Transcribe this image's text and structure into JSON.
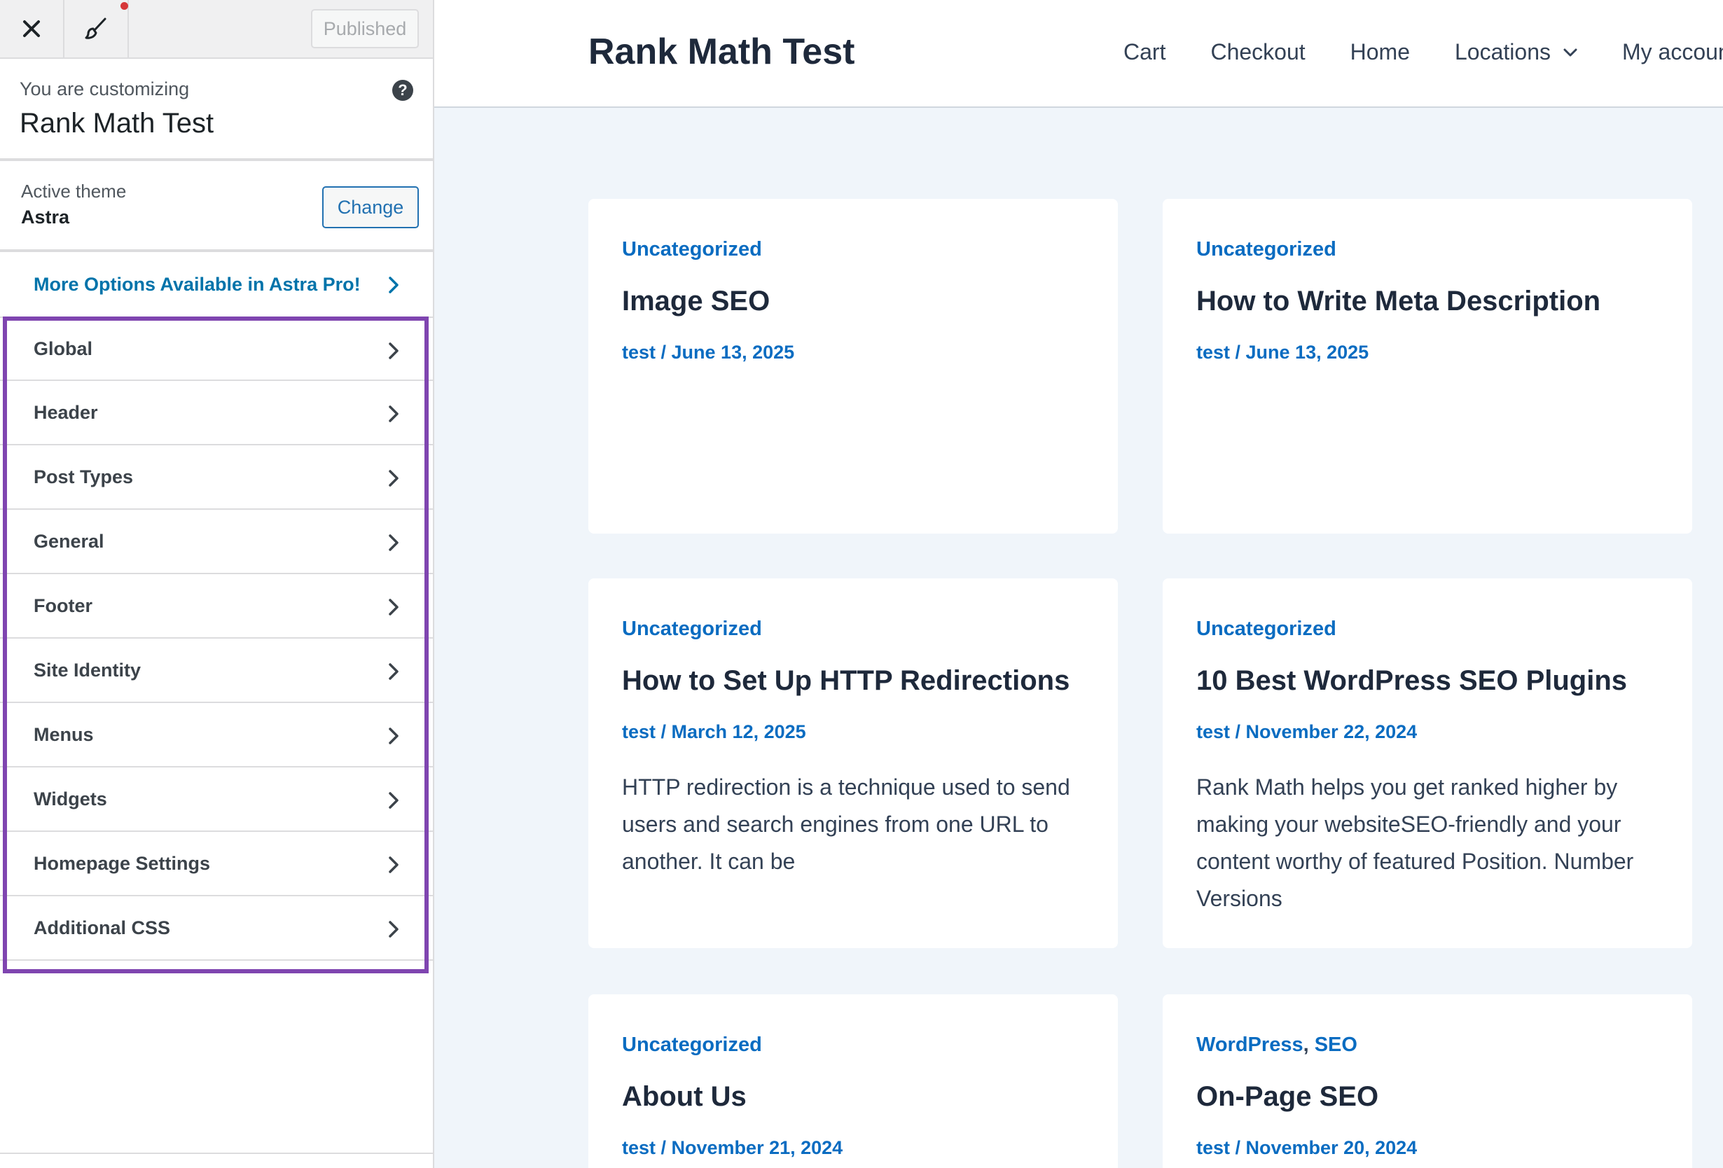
{
  "toolbar": {
    "close_icon": "close-icon",
    "brush_icon": "paintbrush-icon",
    "published_label": "Published"
  },
  "customizing": {
    "label": "You are customizing",
    "site_name": "Rank Math Test",
    "help_symbol": "?"
  },
  "theme": {
    "label": "Active theme",
    "name": "Astra",
    "change_label": "Change"
  },
  "astra_pro": {
    "label": "More Options Available in Astra Pro!"
  },
  "menu": {
    "items": [
      {
        "label": "Global"
      },
      {
        "label": "Header"
      },
      {
        "label": "Post Types"
      },
      {
        "label": "General"
      },
      {
        "label": "Footer"
      },
      {
        "label": "Site Identity"
      },
      {
        "label": "Menus"
      },
      {
        "label": "Widgets"
      },
      {
        "label": "Homepage Settings"
      },
      {
        "label": "Additional CSS"
      }
    ]
  },
  "colors": {
    "accent": "#2271b1",
    "link": "#0a6cc1",
    "highlight": "#7f45b0",
    "notification": "#d63638"
  },
  "site": {
    "title": "Rank Math Test",
    "nav": [
      {
        "label": "Cart"
      },
      {
        "label": "Checkout"
      },
      {
        "label": "Home"
      },
      {
        "label": "Locations"
      },
      {
        "label": "My account"
      }
    ]
  },
  "posts": [
    {
      "category": "Uncategorized",
      "title": "Image SEO",
      "author": "test",
      "date": "June 13, 2025",
      "excerpt": ""
    },
    {
      "category": "Uncategorized",
      "title": "How to Write Meta Description",
      "author": "test",
      "date": "June 13, 2025",
      "excerpt": ""
    },
    {
      "category": "Uncategorized",
      "title": "How to Set Up HTTP Redirections",
      "author": "test",
      "date": "March 12, 2025",
      "excerpt": "HTTP redirection is a technique used to send users and search engines from one URL to another. It can be"
    },
    {
      "category": "Uncategorized",
      "title": "10 Best WordPress SEO Plugins",
      "author": "test",
      "date": "November 22, 2024",
      "excerpt": "Rank Math helps you get ranked higher by making your websiteSEO-friendly and your content worthy of featured Position. Number Versions"
    },
    {
      "category": "Uncategorized",
      "title": "About Us",
      "author": "test",
      "date": "November 21, 2024",
      "excerpt": ""
    },
    {
      "category": "WordPress",
      "category2": "SEO",
      "title": "On-Page SEO",
      "author": "test",
      "date": "November 20, 2024",
      "excerpt": ""
    }
  ],
  "meta_separator": " / "
}
